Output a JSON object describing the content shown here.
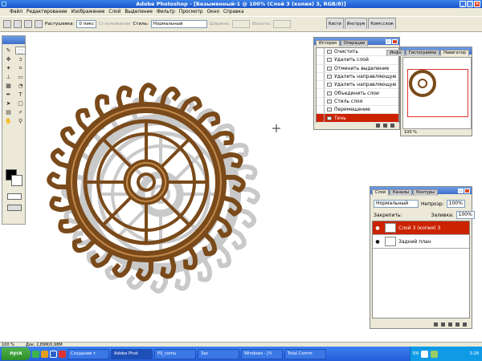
{
  "title": "Adobe Photoshop - [Безымянный-1 @ 100% (Слой 3 (копия) 3, RGB/8)]",
  "menu": [
    "Файл",
    "Редактирование",
    "Изображение",
    "Слой",
    "Выделение",
    "Фильтр",
    "Просмотр",
    "Окно",
    "Справка"
  ],
  "options": {
    "feather_label": "Растушевка:",
    "feather_value": "0 пикс",
    "antialias_label": "Сглаживание",
    "style_label": "Стиль:",
    "style_value": "Нормальный",
    "width_label": "Ширина:",
    "height_label": "Высота:"
  },
  "well_tabs": [
    "Кисти",
    "Инструм",
    "Комп.слож"
  ],
  "history": {
    "tabs": [
      "История",
      "Операции"
    ],
    "items": [
      "Очистить",
      "Удалить слой",
      "Отменить выделение",
      "Удалить направляющую",
      "Удалить направляющую",
      "Объединить слои",
      "Стиль слоя",
      "Перемещение",
      "Тень"
    ]
  },
  "navigator": {
    "tabs": [
      "Навигатор",
      "Гистограмма",
      "Инфо"
    ],
    "zoom": "100 %"
  },
  "layers": {
    "tabs": [
      "Слои",
      "Каналы",
      "Контуры"
    ],
    "blend": "Нормальный",
    "opacity_label": "Непрозр:",
    "opacity": "100%",
    "lock_label": "Закрепить:",
    "fill_label": "Заливка:",
    "fill": "100%",
    "rows": [
      {
        "name": "Слой 3 (копия) 3"
      },
      {
        "name": "Задний план"
      }
    ]
  },
  "status": {
    "zoom": "100 %",
    "doc": "Док: 2,89M/0,98M"
  },
  "taskbar": {
    "start": "пуск",
    "tasks": [
      "Создание т",
      "Adobe Phot",
      "PS_comu",
      "Зас",
      "Windows - [Ч",
      "Total Comm"
    ],
    "lang": "EN",
    "time": "3:28"
  },
  "colors": {
    "gear": "#7a4a1a",
    "gear_light": "#c2894a",
    "shadow": "#c9c9c9",
    "selection": "#cc2200",
    "xp_blue": "#245ddb"
  },
  "icons": [
    "brush-tool-icon",
    "marquee-tool-icon",
    "move-tool-icon",
    "lasso-tool-icon",
    "wand-tool-icon",
    "crop-tool-icon",
    "stamp-tool-icon",
    "eraser-tool-icon",
    "gradient-tool-icon",
    "blur-tool-icon",
    "pen-tool-icon",
    "type-tool-icon",
    "path-tool-icon",
    "shape-tool-icon",
    "notes-tool-icon",
    "eyedropper-tool-icon",
    "hand-tool-icon",
    "zoom-tool-icon"
  ]
}
